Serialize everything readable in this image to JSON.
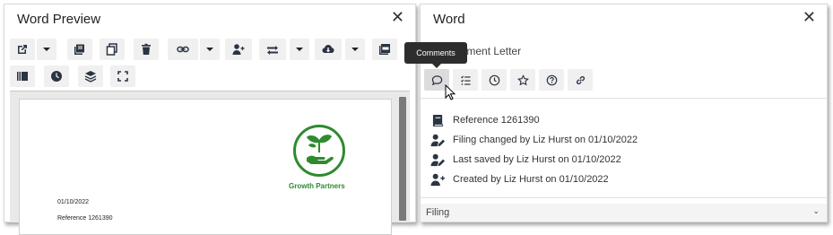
{
  "left_panel": {
    "title": "Word Preview",
    "close_label": "✕",
    "toolbar_icons": [
      "open-external-icon",
      "dropdown-caret-icon",
      "library-icon",
      "copy-icon",
      "delete-icon",
      "link-icon",
      "dropdown-caret-icon",
      "add-user-icon",
      "swap-icon",
      "dropdown-caret-icon",
      "cloud-download-icon",
      "dropdown-caret-icon",
      "pdf-icon",
      "panel-layout-icon",
      "clock-icon",
      "layers-icon",
      "fullscreen-icon"
    ],
    "document": {
      "logo_text": "Growth Partners",
      "date_line": "01/10/2022",
      "reference_line": "Reference 1261390"
    }
  },
  "right_panel": {
    "title": "Word",
    "close_label": "✕",
    "subtitle": "Engagement Letter",
    "tooltip": "Comments",
    "tabs": [
      {
        "name": "comments",
        "icon": "comment-icon"
      },
      {
        "name": "checklist",
        "icon": "checklist-icon"
      },
      {
        "name": "history",
        "icon": "clock-icon"
      },
      {
        "name": "favorite",
        "icon": "star-icon"
      },
      {
        "name": "help",
        "icon": "help-icon"
      },
      {
        "name": "links",
        "icon": "link-icon"
      }
    ],
    "info": [
      {
        "icon": "book-icon",
        "text": "Reference 1261390"
      },
      {
        "icon": "user-edit-icon",
        "text": "Filing changed by Liz Hurst on 01/10/2022"
      },
      {
        "icon": "user-edit-icon",
        "text": "Last saved by Liz Hurst on 01/10/2022"
      },
      {
        "icon": "user-add-icon",
        "text": "Created by Liz Hurst on 01/10/2022"
      }
    ],
    "filing_label": "Filing"
  },
  "colors": {
    "brand_green": "#2e8b2e",
    "icon_dark": "#2b3443",
    "tooltip_bg": "#2d2d2d"
  }
}
